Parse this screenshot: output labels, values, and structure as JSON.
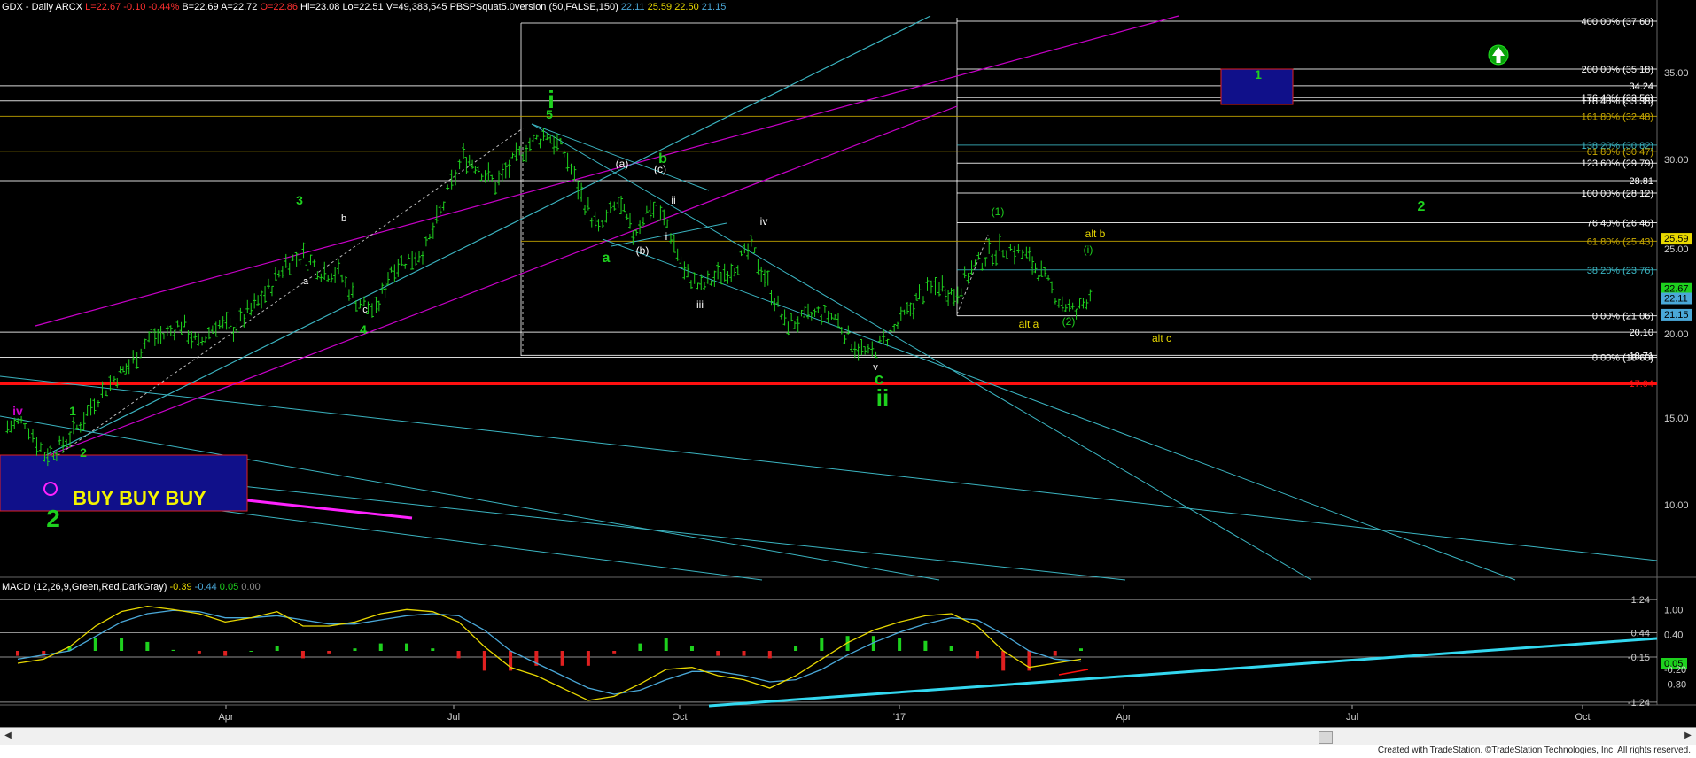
{
  "header": {
    "symbol": "GDX - Daily",
    "exchange": "ARCX",
    "last": "L=22.67",
    "change": "-0.10",
    "pct_change": "-0.44%",
    "bid": "B=22.69",
    "ask": "A=22.72",
    "open": "O=22.86",
    "high": "Hi=23.08",
    "low": "Lo=22.51",
    "volume": "V=49,383,545",
    "study": "PBSPSquat5.0version (50,FALSE,150)",
    "study_vals": [
      "22.11",
      "25.59",
      "22.50",
      "21.15"
    ]
  },
  "macd_header": {
    "label": "MACD (12,26,9,Green,Red,DarkGray)",
    "vals": [
      "-0.39",
      "-0.44",
      "0.05",
      "0.00"
    ]
  },
  "footer": {
    "credit": "Created with TradeStation. ©TradeStation Technologies, Inc. All rights reserved."
  },
  "colors": {
    "background": "#000000",
    "bars": "#1ed11e",
    "channel_magenta": "#c800c8",
    "channel_cyan": "#3bb5c2",
    "support_red": "#ff1010",
    "fib_white": "#d0d0d0",
    "fib_gold": "#c8a800",
    "wave_green": "#1ed11e",
    "wave_yellow": "#e8d800",
    "macd_line": "#e8d800",
    "signal_line": "#4aa8d8",
    "hist_pos": "#1ed11e",
    "hist_neg": "#e02020",
    "trendline_cyan": "#33d8f0",
    "box_blue": "#10108a"
  },
  "chart_data": [
    {
      "type": "ohlc-bar",
      "title": "GDX - Daily",
      "x_axis_labels": [
        "Apr",
        "Jul",
        "Oct",
        "'17",
        "Apr",
        "Jul",
        "Oct"
      ],
      "y_axis_ticks": [
        "35.00",
        "30.00",
        "25.00",
        "20.00",
        "15.00",
        "10.00"
      ],
      "ylim": [
        8,
        39
      ],
      "price_path": [
        [
          "2016-01-04",
          14.5
        ],
        [
          "2016-01-11",
          14.8
        ],
        [
          "2016-01-19",
          12.9
        ],
        [
          "2016-01-25",
          13.3
        ],
        [
          "2016-02-01",
          14.4
        ],
        [
          "2016-02-08",
          16.0
        ],
        [
          "2016-02-16",
          17.3
        ],
        [
          "2016-02-22",
          18.1
        ],
        [
          "2016-03-01",
          19.8
        ],
        [
          "2016-03-07",
          19.9
        ],
        [
          "2016-03-14",
          20.6
        ],
        [
          "2016-03-21",
          19.3
        ],
        [
          "2016-03-28",
          20.6
        ],
        [
          "2016-04-04",
          20.3
        ],
        [
          "2016-04-11",
          21.4
        ],
        [
          "2016-04-18",
          22.6
        ],
        [
          "2016-04-25",
          24.2
        ],
        [
          "2016-05-02",
          24.6
        ],
        [
          "2016-05-09",
          23.7
        ],
        [
          "2016-05-16",
          23.6
        ],
        [
          "2016-05-23",
          22.0
        ],
        [
          "2016-05-31",
          21.3
        ],
        [
          "2016-06-06",
          23.9
        ],
        [
          "2016-06-13",
          24.4
        ],
        [
          "2016-06-20",
          25.0
        ],
        [
          "2016-06-27",
          27.5
        ],
        [
          "2016-07-05",
          30.2
        ],
        [
          "2016-07-11",
          29.6
        ],
        [
          "2016-07-18",
          28.6
        ],
        [
          "2016-07-25",
          29.8
        ],
        [
          "2016-08-01",
          30.9
        ],
        [
          "2016-08-08",
          31.5
        ],
        [
          "2016-08-15",
          30.4
        ],
        [
          "2016-08-22",
          28.0
        ],
        [
          "2016-08-29",
          26.0
        ],
        [
          "2016-09-06",
          27.6
        ],
        [
          "2016-09-12",
          25.8
        ],
        [
          "2016-09-19",
          27.4
        ],
        [
          "2016-09-26",
          26.4
        ],
        [
          "2016-10-03",
          23.6
        ],
        [
          "2016-10-10",
          22.7
        ],
        [
          "2016-10-17",
          23.4
        ],
        [
          "2016-10-24",
          24.0
        ],
        [
          "2016-10-31",
          25.0
        ],
        [
          "2016-11-07",
          23.0
        ],
        [
          "2016-11-14",
          20.6
        ],
        [
          "2016-11-21",
          20.8
        ],
        [
          "2016-11-28",
          21.2
        ],
        [
          "2016-12-05",
          21.0
        ],
        [
          "2016-12-12",
          19.5
        ],
        [
          "2016-12-19",
          18.7
        ],
        [
          "2016-12-27",
          19.8
        ],
        [
          "2017-01-03",
          21.0
        ],
        [
          "2017-01-09",
          22.2
        ],
        [
          "2017-01-17",
          22.9
        ],
        [
          "2017-01-23",
          22.3
        ],
        [
          "2017-01-30",
          23.8
        ],
        [
          "2017-02-06",
          24.7
        ],
        [
          "2017-02-13",
          25.1
        ],
        [
          "2017-02-21",
          24.6
        ],
        [
          "2017-02-27",
          23.5
        ],
        [
          "2017-03-06",
          22.0
        ],
        [
          "2017-03-13",
          21.2
        ],
        [
          "2017-03-20",
          22.7
        ]
      ],
      "price_labels": [
        {
          "text": "35.00",
          "color": "#d0d0d0"
        },
        {
          "text": "34.24",
          "color": "#ffffff"
        },
        {
          "text": "200.00% (35.18)",
          "color": "#ffffff"
        },
        {
          "text": "400.00% (37.60)",
          "color": "#ffffff"
        },
        {
          "text": "176.40% (33.38)",
          "color": "#ffffff"
        },
        {
          "text": "176.40% (33.56)",
          "color": "#ffffff"
        },
        {
          "text": "161.80% (32.48)",
          "color": "#c8a800"
        },
        {
          "text": "138.20% (30.82)",
          "color": "#3bb5c2"
        },
        {
          "text": "61.80% (30.47)",
          "color": "#c8a800"
        },
        {
          "text": "123.60% (29.79)",
          "color": "#ffffff"
        },
        {
          "text": "30.00",
          "color": "#d0d0d0"
        },
        {
          "text": "28.81",
          "color": "#ffffff"
        },
        {
          "text": "100.00% (28.12)",
          "color": "#ffffff"
        },
        {
          "text": "76.40% (26.46)",
          "color": "#ffffff"
        },
        {
          "text": "61.80% (25.43)",
          "color": "#c8a800"
        },
        {
          "text": "25.00",
          "color": "#d0d0d0"
        },
        {
          "text": "25.59",
          "color": "#000000"
        },
        {
          "text": "38.20% (23.76)",
          "color": "#3bb5c2"
        },
        {
          "text": "22.67",
          "color": "#000000"
        },
        {
          "text": "22.11",
          "color": "#000000"
        },
        {
          "text": "0.00% (21.06)",
          "color": "#ffffff"
        },
        {
          "text": "21.15",
          "color": "#000000"
        },
        {
          "text": "20.10",
          "color": "#ffffff"
        },
        {
          "text": "20.00",
          "color": "#d0d0d0"
        },
        {
          "text": "18.71",
          "color": "#ffffff"
        },
        {
          "text": "0.00% (18.60)",
          "color": "#ffffff"
        },
        {
          "text": "17.04",
          "color": "#ff1010"
        },
        {
          "text": "15.00",
          "color": "#d0d0d0"
        },
        {
          "text": "10.00",
          "color": "#d0d0d0"
        }
      ],
      "horizontal_levels": [
        37.6,
        35.18,
        34.24,
        33.56,
        33.38,
        32.48,
        30.82,
        30.47,
        29.79,
        28.81,
        28.12,
        26.46,
        25.43,
        23.76,
        21.06,
        20.1,
        18.71,
        18.6,
        17.04
      ],
      "support_line": 17.04,
      "wave_labels": [
        {
          "text": "i",
          "color": "#1ed11e",
          "size": "large"
        },
        {
          "text": "5",
          "color": "#1ed11e"
        },
        {
          "text": "3",
          "color": "#1ed11e"
        },
        {
          "text": "b",
          "color": "#1ed11e"
        },
        {
          "text": "a",
          "color": "#1ed11e"
        },
        {
          "text": "c",
          "color": "#1ed11e"
        },
        {
          "text": "ii",
          "color": "#1ed11e",
          "size": "large"
        },
        {
          "text": "4",
          "color": "#1ed11e"
        },
        {
          "text": "1",
          "color": "#1ed11e"
        },
        {
          "text": "2",
          "color": "#1ed11e"
        },
        {
          "text": "2",
          "color": "#1ed11e",
          "size": "large"
        },
        {
          "text": "iv",
          "color": "#c800c8"
        },
        {
          "text": "1",
          "color": "#1ed11e"
        },
        {
          "text": "2",
          "color": "#1ed11e"
        },
        {
          "text": "(a)",
          "color": "#ffffff"
        },
        {
          "text": "(b)",
          "color": "#ffffff"
        },
        {
          "text": "(c)",
          "color": "#ffffff"
        },
        {
          "text": "ii",
          "color": "#ffffff"
        },
        {
          "text": "i",
          "color": "#ffffff"
        },
        {
          "text": "iii",
          "color": "#ffffff"
        },
        {
          "text": "iv",
          "color": "#ffffff"
        },
        {
          "text": "v",
          "color": "#ffffff"
        },
        {
          "text": "b",
          "color": "#ffffff"
        },
        {
          "text": "a",
          "color": "#ffffff"
        },
        {
          "text": "c",
          "color": "#ffffff"
        },
        {
          "text": "(1)",
          "color": "#1ed11e"
        },
        {
          "text": "(2)",
          "color": "#1ed11e"
        },
        {
          "text": "(i)",
          "color": "#1ed11e"
        },
        {
          "text": "alt b",
          "color": "#e8d800"
        },
        {
          "text": "alt a",
          "color": "#e8d800"
        },
        {
          "text": "alt c",
          "color": "#e8d800"
        }
      ],
      "annotation": "BUY BUY BUY"
    },
    {
      "type": "macd",
      "title": "MACD (12,26,9,Green,Red,DarkGray)",
      "ylim": [
        -1.35,
        1.35
      ],
      "right_labels": [
        "1.24",
        "1.00",
        "0.44",
        "0.40",
        "-0.15",
        "0.05",
        "-0.20",
        "-0.80",
        "-1.24"
      ],
      "macd": [
        -0.3,
        -0.2,
        0.1,
        0.6,
        0.95,
        1.08,
        1.0,
        0.9,
        0.7,
        0.8,
        0.95,
        0.6,
        0.6,
        0.7,
        0.9,
        1.0,
        0.95,
        0.7,
        0.1,
        -0.4,
        -0.6,
        -0.9,
        -1.2,
        -1.1,
        -0.8,
        -0.45,
        -0.4,
        -0.6,
        -0.7,
        -0.9,
        -0.6,
        -0.2,
        0.2,
        0.5,
        0.7,
        0.85,
        0.9,
        0.6,
        0.0,
        -0.4,
        -0.3,
        -0.2
      ],
      "signal": [
        -0.2,
        -0.1,
        0.0,
        0.35,
        0.7,
        0.9,
        0.98,
        0.95,
        0.8,
        0.8,
        0.85,
        0.75,
        0.65,
        0.65,
        0.75,
        0.85,
        0.9,
        0.85,
        0.5,
        0.0,
        -0.3,
        -0.6,
        -0.9,
        -1.05,
        -0.95,
        -0.7,
        -0.5,
        -0.5,
        -0.6,
        -0.75,
        -0.7,
        -0.45,
        -0.1,
        0.2,
        0.45,
        0.65,
        0.8,
        0.75,
        0.4,
        0.0,
        -0.2,
        -0.25
      ]
    }
  ]
}
